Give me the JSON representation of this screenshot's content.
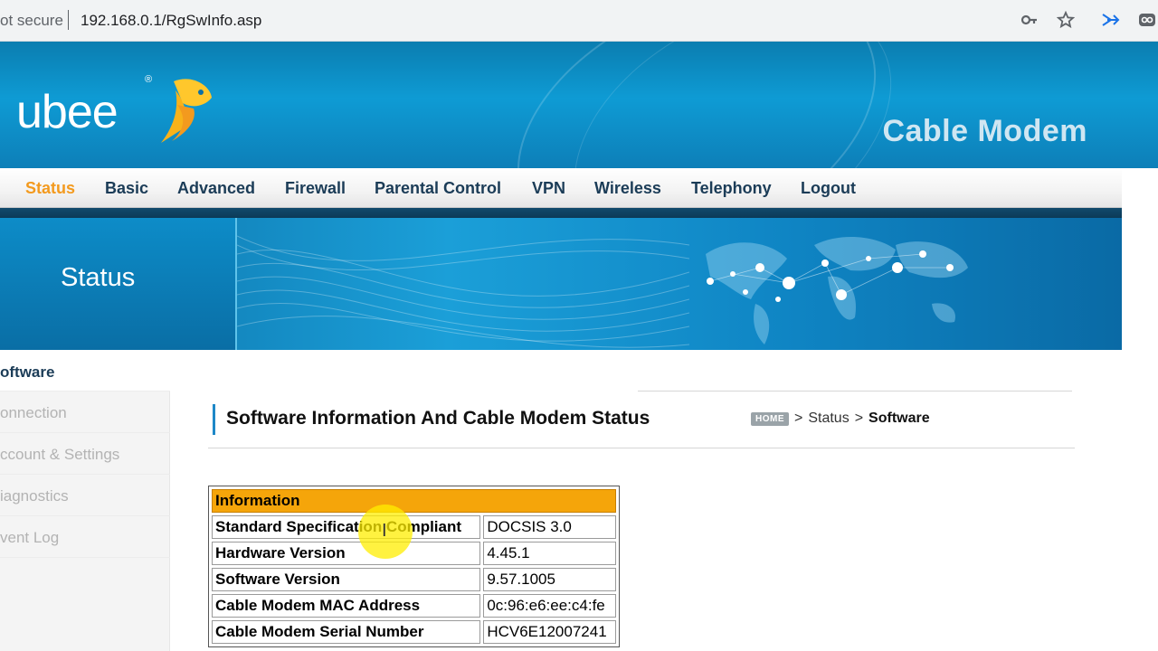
{
  "browser": {
    "security_label": "ot secure",
    "url": "192.168.0.1/RgSwInfo.asp",
    "icons": [
      "key-icon",
      "star-icon",
      "send-tab-icon",
      "extension-icon"
    ]
  },
  "header": {
    "logo_text": "ubee",
    "logo_registered": "®",
    "product_title": "Cable Modem"
  },
  "nav": {
    "items": [
      {
        "label": "Status",
        "active": true
      },
      {
        "label": "Basic",
        "active": false
      },
      {
        "label": "Advanced",
        "active": false
      },
      {
        "label": "Firewall",
        "active": false
      },
      {
        "label": "Parental Control",
        "active": false
      },
      {
        "label": "VPN",
        "active": false
      },
      {
        "label": "Wireless",
        "active": false
      },
      {
        "label": "Telephony",
        "active": false
      },
      {
        "label": "Logout",
        "active": false
      }
    ]
  },
  "banner": {
    "title": "Status"
  },
  "sidebar": {
    "items": [
      {
        "label": "oftware",
        "active": true
      },
      {
        "label": "onnection",
        "active": false
      },
      {
        "label": "ccount & Settings",
        "active": false
      },
      {
        "label": "iagnostics",
        "active": false
      },
      {
        "label": "vent Log",
        "active": false
      }
    ]
  },
  "main": {
    "heading": "Software Information And Cable Modem Status",
    "breadcrumb": {
      "home": "HOME",
      "sep": ">",
      "parent": "Status",
      "current": "Software"
    },
    "table": {
      "header": "Information",
      "rows": [
        {
          "label": "Standard Specification Compliant",
          "value": "DOCSIS 3.0"
        },
        {
          "label": "Hardware Version",
          "value": "4.45.1"
        },
        {
          "label": "Software Version",
          "value": "9.57.1005"
        },
        {
          "label": "Cable Modem MAC Address",
          "value": "0c:96:e6:ee:c4:fe"
        },
        {
          "label": "Cable Modem Serial Number",
          "value": "HCV6E12007241"
        }
      ]
    }
  },
  "colors": {
    "nav_active": "#f39a1e",
    "nav_text": "#1b3c57",
    "table_header": "#f5a50a",
    "brand_blue": "#0e9bd4"
  }
}
